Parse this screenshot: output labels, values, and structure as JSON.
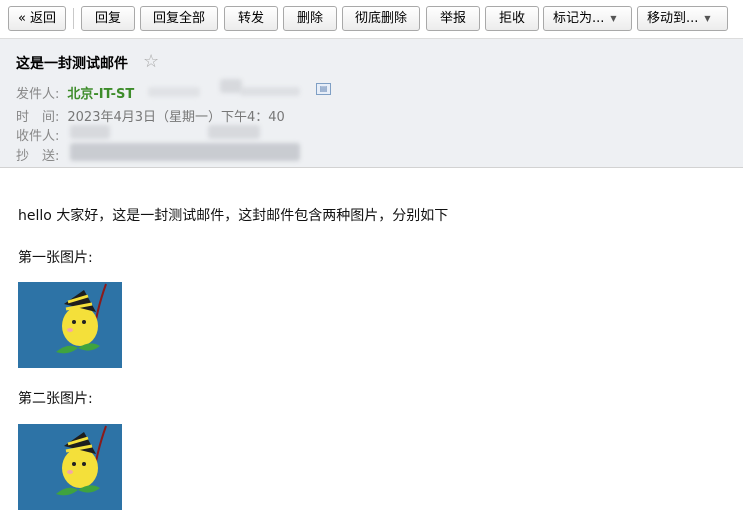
{
  "toolbar": {
    "back": "« 返回",
    "reply": "回复",
    "reply_all": "回复全部",
    "forward": "转发",
    "delete": "删除",
    "delete_forever": "彻底删除",
    "report": "举报",
    "reject": "拒收",
    "mark_as": "标记为...",
    "move_to": "移动到..."
  },
  "email": {
    "subject": "这是一封测试邮件",
    "from_label": "发件人:",
    "from_name": "北京-IT-ST",
    "time_label": "时　间:",
    "time_value": "2023年4月3日（星期一）下午4：40",
    "to_label": "收件人:",
    "cc_label": "抄　送:"
  },
  "content": {
    "intro": "hello 大家好，这是一封测试邮件，这封邮件包含两种图片，分别如下",
    "first_label": "第一张图片:",
    "second_label": "第二张图片:"
  },
  "colors": {
    "sender": "#3d8c2a",
    "header_bg": "#eef0f3",
    "image_bg": "#2d73a6"
  }
}
